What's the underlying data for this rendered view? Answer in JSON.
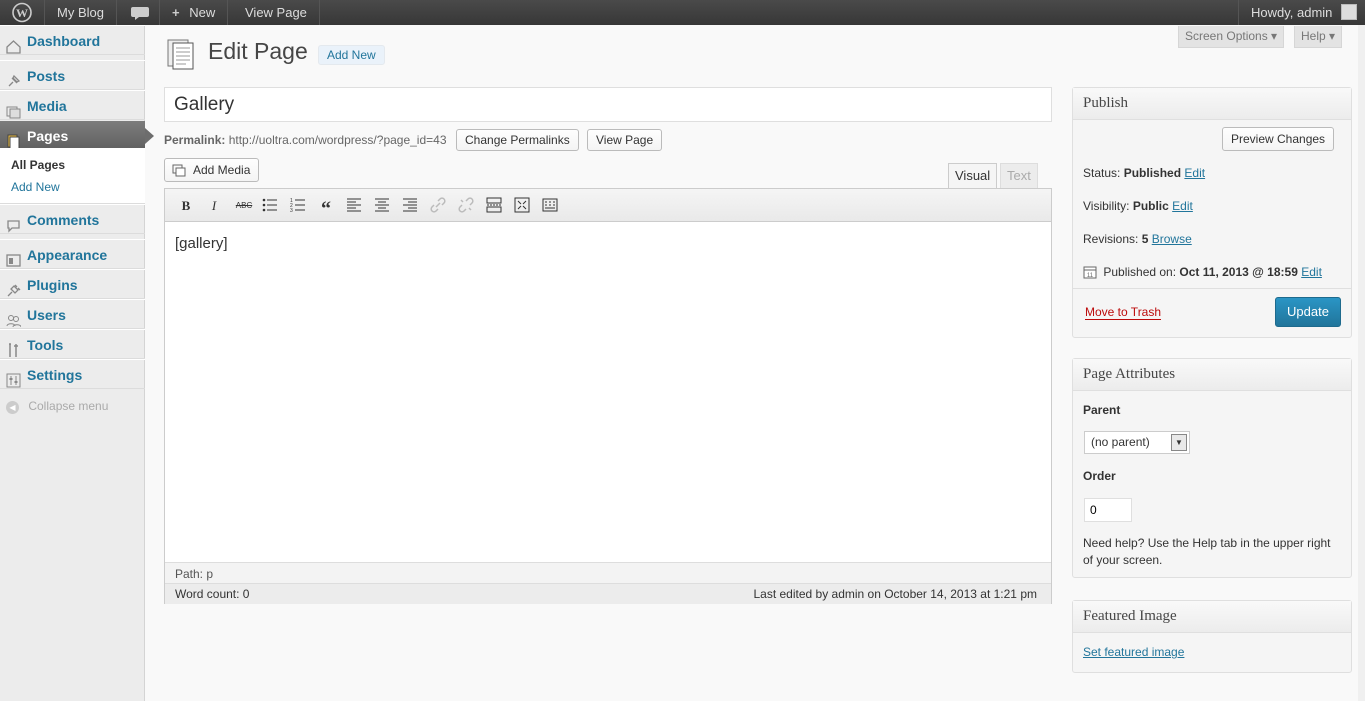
{
  "adminbar": {
    "site_name": "My Blog",
    "new_label": "New",
    "view_page_label": "View Page",
    "howdy": "Howdy, admin"
  },
  "sidebar": {
    "items": [
      {
        "label": "Dashboard"
      },
      {
        "label": "Posts"
      },
      {
        "label": "Media"
      },
      {
        "label": "Pages"
      },
      {
        "label": "Comments"
      },
      {
        "label": "Appearance"
      },
      {
        "label": "Plugins"
      },
      {
        "label": "Users"
      },
      {
        "label": "Tools"
      },
      {
        "label": "Settings"
      }
    ],
    "submenu": [
      "All Pages",
      "Add New"
    ],
    "collapse": "Collapse menu"
  },
  "header": {
    "title": "Edit Page",
    "add_new": "Add New",
    "screen_options": "Screen Options ▾",
    "help": "Help ▾"
  },
  "post": {
    "title": "Gallery",
    "permalink_label": "Permalink:",
    "permalink_url": "http://uoltra.com/wordpress/?page_id=43",
    "change_permalinks": "Change Permalinks",
    "view_page": "View Page"
  },
  "editor": {
    "add_media": "Add Media",
    "tab_visual": "Visual",
    "tab_text": "Text",
    "content": "[gallery]",
    "path": "Path: p",
    "word_count": "Word count: 0",
    "last_edited": "Last edited by admin on October 14, 2013 at 1:21 pm"
  },
  "publish": {
    "title": "Publish",
    "preview": "Preview Changes",
    "status_label": "Status:",
    "status_value": "Published",
    "visibility_label": "Visibility:",
    "visibility_value": "Public",
    "revisions_label": "Revisions:",
    "revisions_value": "5",
    "browse": "Browse",
    "published_on_label": "Published on:",
    "published_on_value": "Oct 11, 2013 @ 18:59",
    "edit": "Edit",
    "trash": "Move to Trash",
    "update": "Update"
  },
  "attributes": {
    "title": "Page Attributes",
    "parent_label": "Parent",
    "parent_value": "(no parent)",
    "order_label": "Order",
    "order_value": "0",
    "help_text_1": "Need help? Use the Help tab in the upper right",
    "help_text_2": "of your screen."
  },
  "featured": {
    "title": "Featured Image",
    "set_link": "Set featured image"
  },
  "colors": {
    "accent": "#21759b",
    "update_button": "#2a95c5",
    "trash": "#bc0b0b"
  }
}
